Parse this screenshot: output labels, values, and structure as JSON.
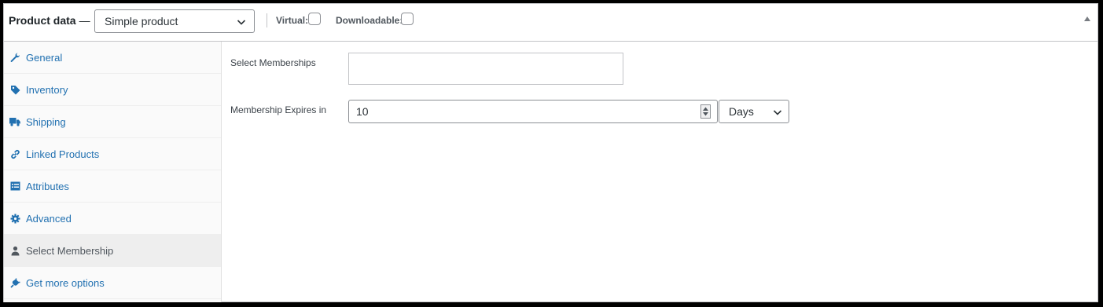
{
  "header": {
    "title": "Product data",
    "dash": "—",
    "product_type": "Simple product",
    "virtual_label": "Virtual:",
    "downloadable_label": "Downloadable:"
  },
  "sidebar": {
    "items": [
      {
        "label": "General",
        "icon": "wrench-icon"
      },
      {
        "label": "Inventory",
        "icon": "tag-icon"
      },
      {
        "label": "Shipping",
        "icon": "truck-icon"
      },
      {
        "label": "Linked Products",
        "icon": "link-icon"
      },
      {
        "label": "Attributes",
        "icon": "list-icon"
      },
      {
        "label": "Advanced",
        "icon": "gear-icon"
      },
      {
        "label": "Select Membership",
        "icon": "person-icon",
        "active": true
      },
      {
        "label": "Get more options",
        "icon": "plug-icon"
      }
    ]
  },
  "main": {
    "memberships_label": "Select Memberships",
    "expires_label": "Membership Expires in",
    "expires_value": "10",
    "expires_unit": "Days"
  },
  "colors": {
    "link": "#2271b1",
    "active_bg": "#eeeeee",
    "border": "#c3c4c7"
  }
}
